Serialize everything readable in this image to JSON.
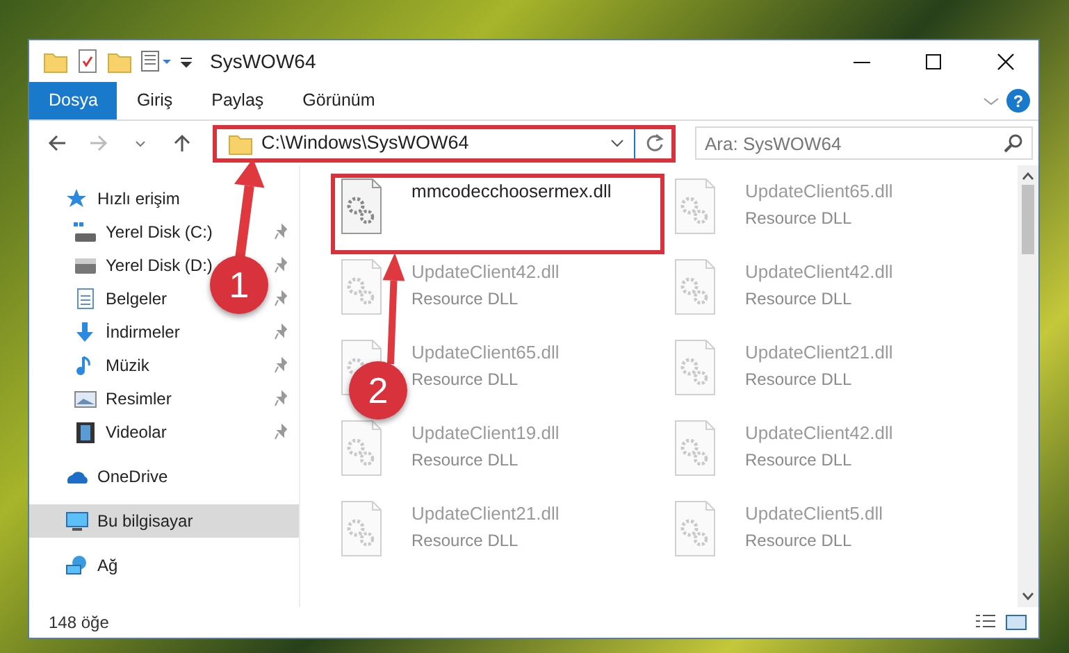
{
  "window": {
    "title": "SysWOW64"
  },
  "ribbon": {
    "tabs": [
      {
        "label": "Dosya",
        "selected": true
      },
      {
        "label": "Giriş",
        "selected": false
      },
      {
        "label": "Paylaş",
        "selected": false
      },
      {
        "label": "Görünüm",
        "selected": false
      }
    ],
    "help": "?"
  },
  "address_bar": {
    "path": "C:\\Windows\\SysWOW64",
    "highlighted": true
  },
  "search": {
    "placeholder": "Ara: SysWOW64"
  },
  "sidebar": {
    "items": [
      {
        "label": "Hızlı erişim",
        "kind": "star",
        "selected": false,
        "children": [
          {
            "label": "Yerel Disk (C:)",
            "kind": "sysdisk",
            "pinned": true
          },
          {
            "label": "Yerel Disk (D:)",
            "kind": "disk",
            "pinned": true
          },
          {
            "label": "Belgeler",
            "kind": "doc",
            "pinned": true
          },
          {
            "label": "İndirmeler",
            "kind": "download",
            "pinned": true
          },
          {
            "label": "Müzik",
            "kind": "music",
            "pinned": true
          },
          {
            "label": "Resimler",
            "kind": "picture",
            "pinned": true
          },
          {
            "label": "Videolar",
            "kind": "video",
            "pinned": true
          }
        ]
      },
      {
        "label": "OneDrive",
        "kind": "cloud",
        "selected": false
      },
      {
        "label": "Bu bilgisayar",
        "kind": "computer",
        "selected": true
      },
      {
        "label": "Ağ",
        "kind": "network",
        "selected": false
      }
    ]
  },
  "files": [
    {
      "name": "mmcodecchoosermex.dll",
      "highlighted": true,
      "faded": false
    },
    {
      "name": "UpdateClient65.dll",
      "type": "Resource DLL",
      "highlighted": false,
      "faded": true
    },
    {
      "name": "UpdateClient42.dll",
      "type": "Resource DLL",
      "highlighted": false,
      "faded": true
    },
    {
      "name": "UpdateClient42.dll",
      "type": "Resource DLL",
      "highlighted": false,
      "faded": true
    },
    {
      "name": "UpdateClient65.dll",
      "type": "Resource DLL",
      "highlighted": false,
      "faded": true
    },
    {
      "name": "UpdateClient21.dll",
      "type": "Resource DLL",
      "highlighted": false,
      "faded": true
    },
    {
      "name": "UpdateClient19.dll",
      "type": "Resource DLL",
      "highlighted": false,
      "faded": true
    },
    {
      "name": "UpdateClient42.dll",
      "type": "Resource DLL",
      "highlighted": false,
      "faded": true
    },
    {
      "name": "UpdateClient21.dll",
      "type": "Resource DLL",
      "highlighted": false,
      "faded": true
    },
    {
      "name": "UpdateClient5.dll",
      "type": "Resource DLL",
      "highlighted": false,
      "faded": true
    }
  ],
  "annotations": [
    {
      "label": "1"
    },
    {
      "label": "2"
    }
  ],
  "status_bar": {
    "count": "148 öğe"
  }
}
